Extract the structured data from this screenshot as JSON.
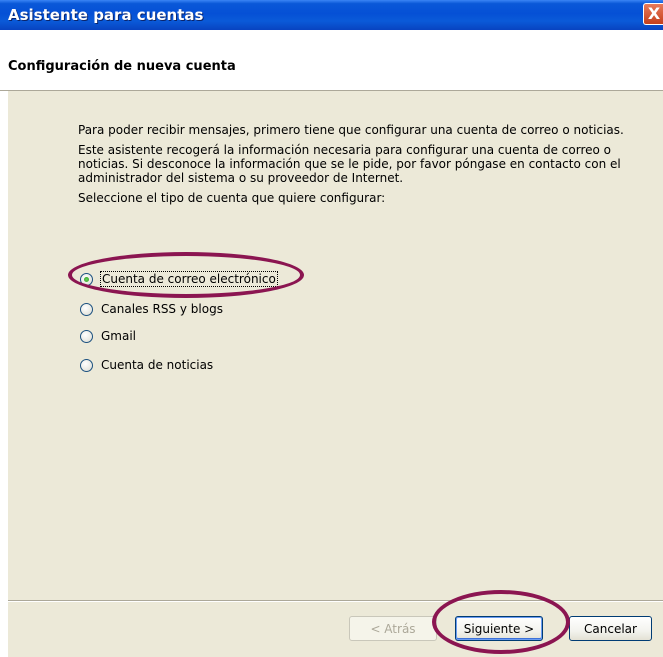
{
  "window": {
    "title": "Asistente para cuentas",
    "close_label": "X"
  },
  "header": {
    "title": "Configuración de nueva cuenta"
  },
  "content": {
    "paragraph1": "Para poder recibir mensajes, primero tiene que configurar una cuenta de correo o noticias.",
    "paragraph2": "Este asistente recogerá la información necesaria para configurar una cuenta de correo o noticias. Si desconoce la información que se le pide, por favor póngase en contacto con el administrador del sistema o su proveedor de Internet.",
    "prompt": "Seleccione el tipo de cuenta que quiere configurar:"
  },
  "account_types": [
    {
      "label": "Cuenta de correo electrónico",
      "selected": true
    },
    {
      "label": "Canales RSS y blogs",
      "selected": false
    },
    {
      "label": "Gmail",
      "selected": false
    },
    {
      "label": "Cuenta de noticias",
      "selected": false
    }
  ],
  "buttons": {
    "back": "< Atrás",
    "next": "Siguiente >",
    "cancel": "Cancelar"
  },
  "colors": {
    "titlebar": "#0550d6",
    "annotation": "#8b1551",
    "dialog_bg": "#ece9d8"
  }
}
